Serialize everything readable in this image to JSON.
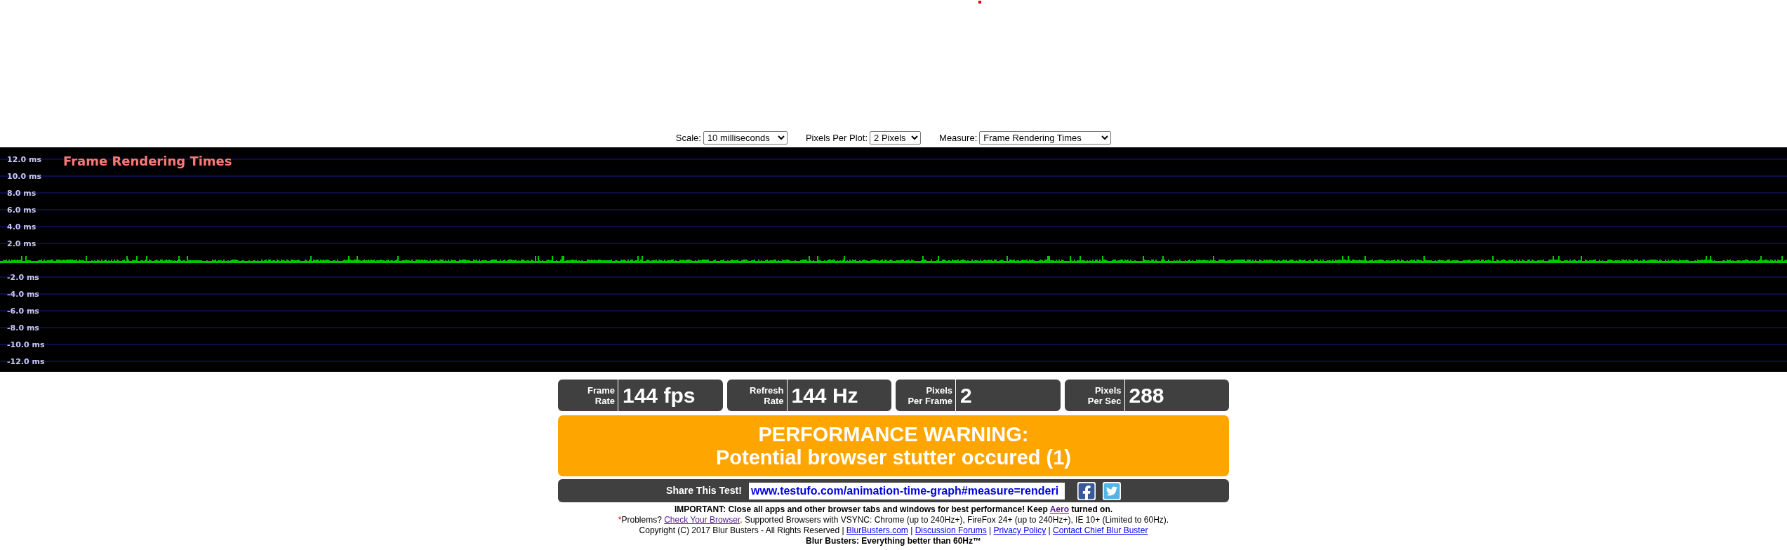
{
  "controls": [
    {
      "label": "Scale:",
      "value": "10 milliseconds"
    },
    {
      "label": "Pixels Per Plot:",
      "value": "2 Pixels"
    },
    {
      "label": "Measure:",
      "value": "Frame Rendering Times"
    }
  ],
  "graph": {
    "title": "Frame Rendering Times",
    "y_labels": [
      "12.0 ms",
      "10.0 ms",
      "8.0 ms",
      "6.0 ms",
      "4.0 ms",
      "2.0 ms",
      "-2.0 ms",
      "-4.0 ms",
      "-6.0 ms",
      "-8.0 ms",
      "-10.0 ms",
      "-12.0 ms"
    ]
  },
  "stats": [
    {
      "label_lines": [
        "Frame",
        "Rate"
      ],
      "value": "144 fps"
    },
    {
      "label_lines": [
        "Refresh",
        "Rate"
      ],
      "value": "144 Hz"
    },
    {
      "label_lines": [
        "Pixels",
        "Per Frame"
      ],
      "value": "2"
    },
    {
      "label_lines": [
        "Pixels",
        "Per Sec"
      ],
      "value": "288"
    }
  ],
  "warning": {
    "title": "PERFORMANCE WARNING:",
    "message": "Potential browser stutter occured (1)"
  },
  "share": {
    "label": "Share This Test!",
    "url": "www.testufo.com/animation-time-graph#measure=renderi"
  },
  "footer": [
    {
      "bold": true,
      "parts": [
        {
          "kind": "text",
          "text": "IMPORTANT: Close all apps and other browser tabs and windows for best performance! Keep "
        },
        {
          "kind": "link",
          "text": "Aero",
          "visited": true
        },
        {
          "kind": "text",
          "text": " turned on."
        }
      ]
    },
    {
      "bold": false,
      "parts": [
        {
          "kind": "mark",
          "text": "*"
        },
        {
          "kind": "text",
          "text": "Problems? "
        },
        {
          "kind": "link",
          "text": "Check Your Browser",
          "visited": true
        },
        {
          "kind": "text",
          "text": ". Supported Browsers with VSYNC: Chrome (up to 240Hz+), FireFox 24+ (up to 240Hz+), IE 10+ (Limited to 60Hz)."
        }
      ]
    },
    {
      "bold": false,
      "parts": [
        {
          "kind": "text",
          "text": "Copyright (C) 2017 Blur Busters - All Rights Reserved | "
        },
        {
          "kind": "link",
          "text": "BlurBusters.com",
          "visited": false
        },
        {
          "kind": "text",
          "text": " | "
        },
        {
          "kind": "link",
          "text": "Discussion Forums",
          "visited": false
        },
        {
          "kind": "text",
          "text": " | "
        },
        {
          "kind": "link",
          "text": "Privacy Policy",
          "visited": false
        },
        {
          "kind": "text",
          "text": " | "
        },
        {
          "kind": "link",
          "text": "Contact Chief Blur Buster",
          "visited": false
        }
      ]
    },
    {
      "bold": true,
      "parts": [
        {
          "kind": "text",
          "text": "Blur Busters: Everything better than 60Hz™"
        }
      ]
    }
  ]
}
